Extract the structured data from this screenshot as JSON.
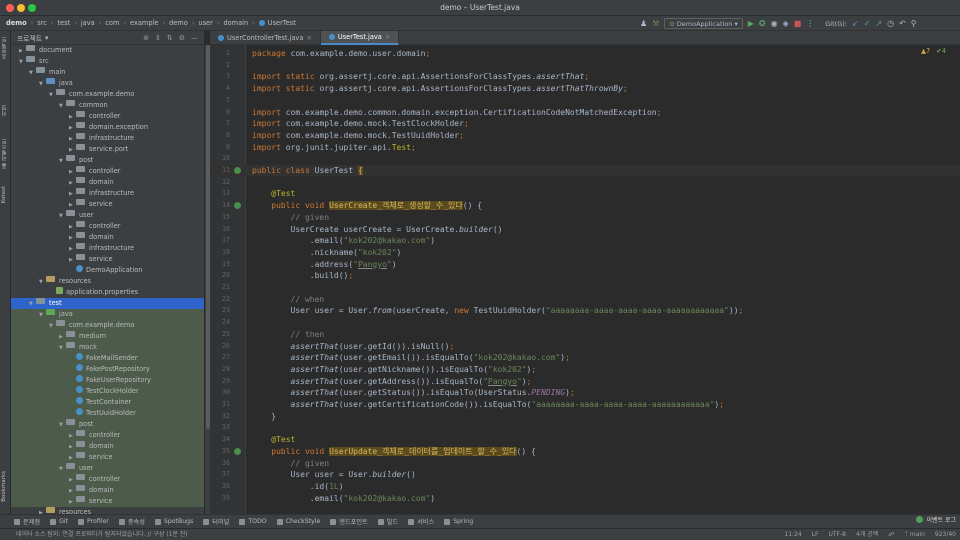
{
  "window": {
    "title": "demo – UserTest.java"
  },
  "breadcrumbs": [
    "demo",
    "src",
    "test",
    "java",
    "com",
    "example",
    "demo",
    "user",
    "domain",
    "UserTest"
  ],
  "toolbar": {
    "run_config": "DemoApplication",
    "git_label": "Git(G):"
  },
  "left_tool_strip": [
    "프로젝트",
    "커밋",
    "풀 리퀘스트",
    "Kotest"
  ],
  "left_tool_strip_bottom": "Bookmarks",
  "project_panel": {
    "title": "프로젝트"
  },
  "tree": [
    {
      "label": "document",
      "depth": 1,
      "kind": "folder",
      "open": false
    },
    {
      "label": "src",
      "depth": 1,
      "kind": "folder",
      "open": true
    },
    {
      "label": "main",
      "depth": 2,
      "kind": "folder",
      "open": true
    },
    {
      "label": "java",
      "depth": 3,
      "kind": "src",
      "open": true
    },
    {
      "label": "com.example.demo",
      "depth": 4,
      "kind": "pkg",
      "open": true
    },
    {
      "label": "common",
      "depth": 5,
      "kind": "pkg",
      "open": true
    },
    {
      "label": "controller",
      "depth": 6,
      "kind": "pkg",
      "open": false
    },
    {
      "label": "domain.exception",
      "depth": 6,
      "kind": "pkg",
      "open": false
    },
    {
      "label": "infrastructure",
      "depth": 6,
      "kind": "pkg",
      "open": false
    },
    {
      "label": "service.port",
      "depth": 6,
      "kind": "pkg",
      "open": false
    },
    {
      "label": "post",
      "depth": 5,
      "kind": "pkg",
      "open": true
    },
    {
      "label": "controller",
      "depth": 6,
      "kind": "pkg",
      "open": false
    },
    {
      "label": "domain",
      "depth": 6,
      "kind": "pkg",
      "open": false
    },
    {
      "label": "infrastructure",
      "depth": 6,
      "kind": "pkg",
      "open": false
    },
    {
      "label": "service",
      "depth": 6,
      "kind": "pkg",
      "open": false
    },
    {
      "label": "user",
      "depth": 5,
      "kind": "pkg",
      "open": true
    },
    {
      "label": "controller",
      "depth": 6,
      "kind": "pkg",
      "open": false
    },
    {
      "label": "domain",
      "depth": 6,
      "kind": "pkg",
      "open": false
    },
    {
      "label": "infrastructure",
      "depth": 6,
      "kind": "pkg",
      "open": false
    },
    {
      "label": "service",
      "depth": 6,
      "kind": "pkg",
      "open": false
    },
    {
      "label": "DemoApplication",
      "depth": 6,
      "kind": "class",
      "open": null
    },
    {
      "label": "resources",
      "depth": 3,
      "kind": "res",
      "open": true
    },
    {
      "label": "application.properties",
      "depth": 4,
      "kind": "leaf",
      "open": null
    },
    {
      "label": "test",
      "depth": 2,
      "kind": "folder",
      "open": true,
      "selected": true
    },
    {
      "label": "java",
      "depth": 3,
      "kind": "test",
      "open": true,
      "test": true
    },
    {
      "label": "com.example.demo",
      "depth": 4,
      "kind": "pkg",
      "open": true,
      "test": true
    },
    {
      "label": "medium",
      "depth": 5,
      "kind": "pkg",
      "open": false,
      "test": true
    },
    {
      "label": "mock",
      "depth": 5,
      "kind": "pkg",
      "open": true,
      "test": true
    },
    {
      "label": "FakeMailSender",
      "depth": 6,
      "kind": "class",
      "open": null,
      "test": true
    },
    {
      "label": "FakePostRepository",
      "depth": 6,
      "kind": "class",
      "open": null,
      "test": true
    },
    {
      "label": "FakeUserRepository",
      "depth": 6,
      "kind": "class",
      "open": null,
      "test": true
    },
    {
      "label": "TestClockHolder",
      "depth": 6,
      "kind": "class",
      "open": null,
      "test": true
    },
    {
      "label": "TestContainer",
      "depth": 6,
      "kind": "class",
      "open": null,
      "test": true
    },
    {
      "label": "TestUuidHolder",
      "depth": 6,
      "kind": "class",
      "open": null,
      "test": true
    },
    {
      "label": "post",
      "depth": 5,
      "kind": "pkg",
      "open": true,
      "test": true
    },
    {
      "label": "controller",
      "depth": 6,
      "kind": "pkg",
      "open": false,
      "test": true
    },
    {
      "label": "domain",
      "depth": 6,
      "kind": "pkg",
      "open": false,
      "test": true
    },
    {
      "label": "service",
      "depth": 6,
      "kind": "pkg",
      "open": false,
      "test": true
    },
    {
      "label": "user",
      "depth": 5,
      "kind": "pkg",
      "open": true,
      "test": true
    },
    {
      "label": "controller",
      "depth": 6,
      "kind": "pkg",
      "open": false,
      "test": true
    },
    {
      "label": "domain",
      "depth": 6,
      "kind": "pkg",
      "open": false,
      "test": true
    },
    {
      "label": "service",
      "depth": 6,
      "kind": "pkg",
      "open": false,
      "test": true
    },
    {
      "label": "resources",
      "depth": 3,
      "kind": "res",
      "open": false
    }
  ],
  "tabs": [
    {
      "label": "UserControllerTest.java",
      "active": false
    },
    {
      "label": "UserTest.java",
      "active": true
    }
  ],
  "inspections": {
    "warnings": "▲7",
    "weak": "✔4"
  },
  "editor_lines": [
    {
      "n": "1",
      "html": "<span class='kw'>package</span> <span class='pkgname'>com.example.demo.user.domain</span><span class='kw'>;</span>"
    },
    {
      "n": "2",
      "html": ""
    },
    {
      "n": "3",
      "html": "<span class='kw'>import static</span> <span class='txt'>org.assertj.core.api.AssertionsForClassTypes.</span><span class='st'>assertThat</span><span class='kw'>;</span>"
    },
    {
      "n": "4",
      "html": "<span class='kw'>import static</span> <span class='txt'>org.assertj.core.api.AssertionsForClassTypes.</span><span class='st'>assertThatThrownBy</span><span class='kw'>;</span>"
    },
    {
      "n": "5",
      "html": ""
    },
    {
      "n": "6",
      "html": "<span class='kw'>import</span> <span class='txt'>com.example.demo.common.domain.exception.CertificationCodeNotMatchedException</span><span class='kw'>;</span>"
    },
    {
      "n": "7",
      "html": "<span class='kw'>import</span> <span class='txt'>com.example.demo.mock.TestClockHolder</span><span class='kw'>;</span>"
    },
    {
      "n": "8",
      "html": "<span class='kw'>import</span> <span class='txt'>com.example.demo.mock.TestUuidHolder</span><span class='kw'>;</span>"
    },
    {
      "n": "9",
      "html": "<span class='kw'>import</span> <span class='txt'>org.junit.jupiter.api.</span><span class='ann'>Test</span><span class='kw'>;</span>"
    },
    {
      "n": "10",
      "html": ""
    },
    {
      "n": "11",
      "html": "<span class='kw'>public class</span> <span class='txt'>UserTest </span><span class='hl-yellow'>{</span>",
      "cur": true,
      "mark": true
    },
    {
      "n": "12",
      "html": ""
    },
    {
      "n": "13",
      "html": "    <span class='ann'>@Test</span>"
    },
    {
      "n": "14",
      "html": "    <span class='kw'>public void</span> <span class='hl-yellow'>UserCreate_객체로_생성할_수_있다</span><span class='txt'>() {</span>",
      "mark": true
    },
    {
      "n": "15",
      "html": "        <span class='cmt'>// given</span>"
    },
    {
      "n": "16",
      "html": "        <span class='txt'>UserCreate userCreate = UserCreate.</span><span class='st'>builder</span><span class='txt'>()</span>"
    },
    {
      "n": "17",
      "html": "            <span class='txt'>.email(</span><span class='str'>\"kok202@kakao.com\"</span><span class='txt'>)</span>"
    },
    {
      "n": "18",
      "html": "            <span class='txt'>.nickname(</span><span class='str'>\"kok202\"</span><span class='txt'>)</span>"
    },
    {
      "n": "19",
      "html": "            <span class='txt'>.address(</span><span class='str'>\"<span class='und'>Pangyo</span>\"</span><span class='txt'>)</span>"
    },
    {
      "n": "20",
      "html": "            <span class='txt'>.build()</span><span class='kw'>;</span>"
    },
    {
      "n": "21",
      "html": ""
    },
    {
      "n": "22",
      "html": "        <span class='cmt'>// when</span>"
    },
    {
      "n": "23",
      "html": "        <span class='txt'>User user = User.</span><span class='st'>from</span><span class='txt'>(userCreate, </span><span class='kw'>new</span> <span class='txt'>TestUuidHolder(</span><span class='str'>\"aaaaaaaa-aaaa-aaaa-aaaa-aaaaaaaaaaaa\"</span><span class='txt'>))</span><span class='kw'>;</span>"
    },
    {
      "n": "24",
      "html": ""
    },
    {
      "n": "25",
      "html": "        <span class='cmt'>// then</span>"
    },
    {
      "n": "26",
      "html": "        <span class='st'>assertThat</span><span class='txt'>(user.getId()).isNull()</span><span class='kw'>;</span>"
    },
    {
      "n": "27",
      "html": "        <span class='st'>assertThat</span><span class='txt'>(user.getEmail()).isEqualTo(</span><span class='str'>\"kok202@kakao.com\"</span><span class='txt'>)</span><span class='kw'>;</span>"
    },
    {
      "n": "28",
      "html": "        <span class='st'>assertThat</span><span class='txt'>(user.getNickname()).isEqualTo(</span><span class='str'>\"kok202\"</span><span class='txt'>)</span><span class='kw'>;</span>"
    },
    {
      "n": "29",
      "html": "        <span class='st'>assertThat</span><span class='txt'>(user.getAddress()).isEqualTo(</span><span class='str'>\"<span class='und'>Pangyo</span>\"</span><span class='txt'>)</span><span class='kw'>;</span>"
    },
    {
      "n": "30",
      "html": "        <span class='st'>assertThat</span><span class='txt'>(user.getStatus()).isEqualTo(UserStatus.</span><span class='fld'>PENDING</span><span class='txt'>)</span><span class='kw'>;</span>"
    },
    {
      "n": "31",
      "html": "        <span class='st'>assertThat</span><span class='txt'>(user.getCertificationCode()).isEqualTo(</span><span class='str'>\"aaaaaaaa-aaaa-aaaa-aaaa-aaaaaaaaaaaa\"</span><span class='txt'>)</span><span class='kw'>;</span>"
    },
    {
      "n": "32",
      "html": "    <span class='txt'>}</span>"
    },
    {
      "n": "33",
      "html": ""
    },
    {
      "n": "34",
      "html": "    <span class='ann'>@Test</span>"
    },
    {
      "n": "35",
      "html": "    <span class='kw'>public void</span> <span class='hl-yellow'>UserUpdate_객체로_데이터를_업데이트_할_수_있다</span><span class='txt'>() {</span>",
      "mark": true
    },
    {
      "n": "36",
      "html": "        <span class='cmt'>// given</span>"
    },
    {
      "n": "37",
      "html": "        <span class='txt'>User user = User.</span><span class='st'>builder</span><span class='txt'>()</span>"
    },
    {
      "n": "38",
      "html": "            <span class='txt'>.id(</span><span class='str'>1L</span><span class='txt'>)</span>"
    },
    {
      "n": "39",
      "html": "            <span class='txt'>.email(</span><span class='str'>\"kok202@kakao.com\"</span><span class='txt'>)</span>"
    }
  ],
  "bottom_tools": [
    "문제점",
    "Git",
    "Profiler",
    "종속성",
    "SpotBugs",
    "터미널",
    "TODO",
    "CheckStyle",
    "엔드포인트",
    "빌드",
    "서비스",
    "Spring"
  ],
  "event_log": "이벤트 로그",
  "status": {
    "message": "데이터 소스 탐지: 연결 프로퍼티가 탐지되었습니다. // 구성 (1분 전)",
    "position": "11:24",
    "line_sep": "LF",
    "encoding": "UTF-8",
    "indent": "4개 공백",
    "branch": "main",
    "memory": "923/40"
  },
  "colors": {
    "accent": "#2f65ca",
    "keyword": "#cc7832",
    "string": "#6a8759",
    "comment": "#808080",
    "annotation": "#bbb529"
  }
}
